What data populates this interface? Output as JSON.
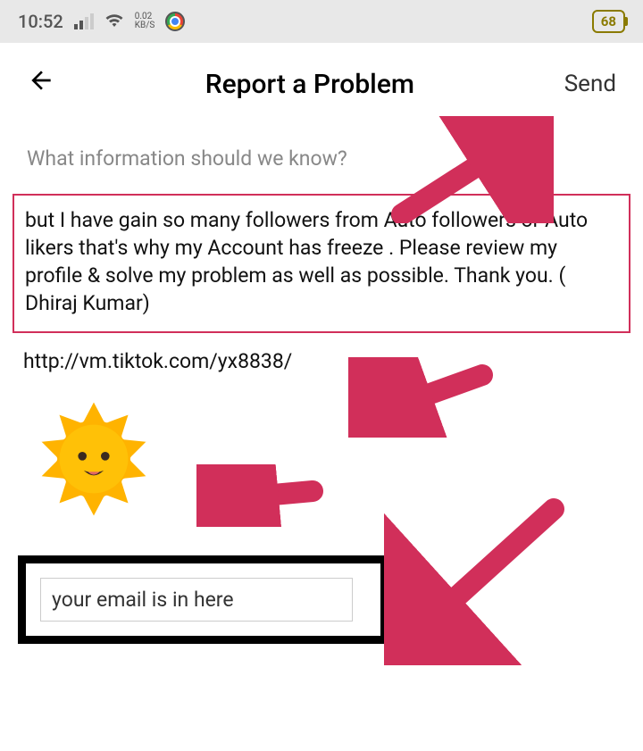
{
  "status": {
    "time": "10:52",
    "data_top": "0.02",
    "data_bottom": "KB/S",
    "battery": "68"
  },
  "header": {
    "title": "Report a Problem",
    "send": "Send"
  },
  "prompt": "What information should we know?",
  "message": "but I have gain so many followers from Auto followers or Auto likers that's why my Account has freeze . Please review my profile & solve my problem as well as possible. Thank you. ( Dhiraj Kumar)",
  "url": "http://vm.tiktok.com/yx8838/",
  "email_text": "your email is in here",
  "annotation": {
    "arrow_color": "#d12f5a"
  }
}
